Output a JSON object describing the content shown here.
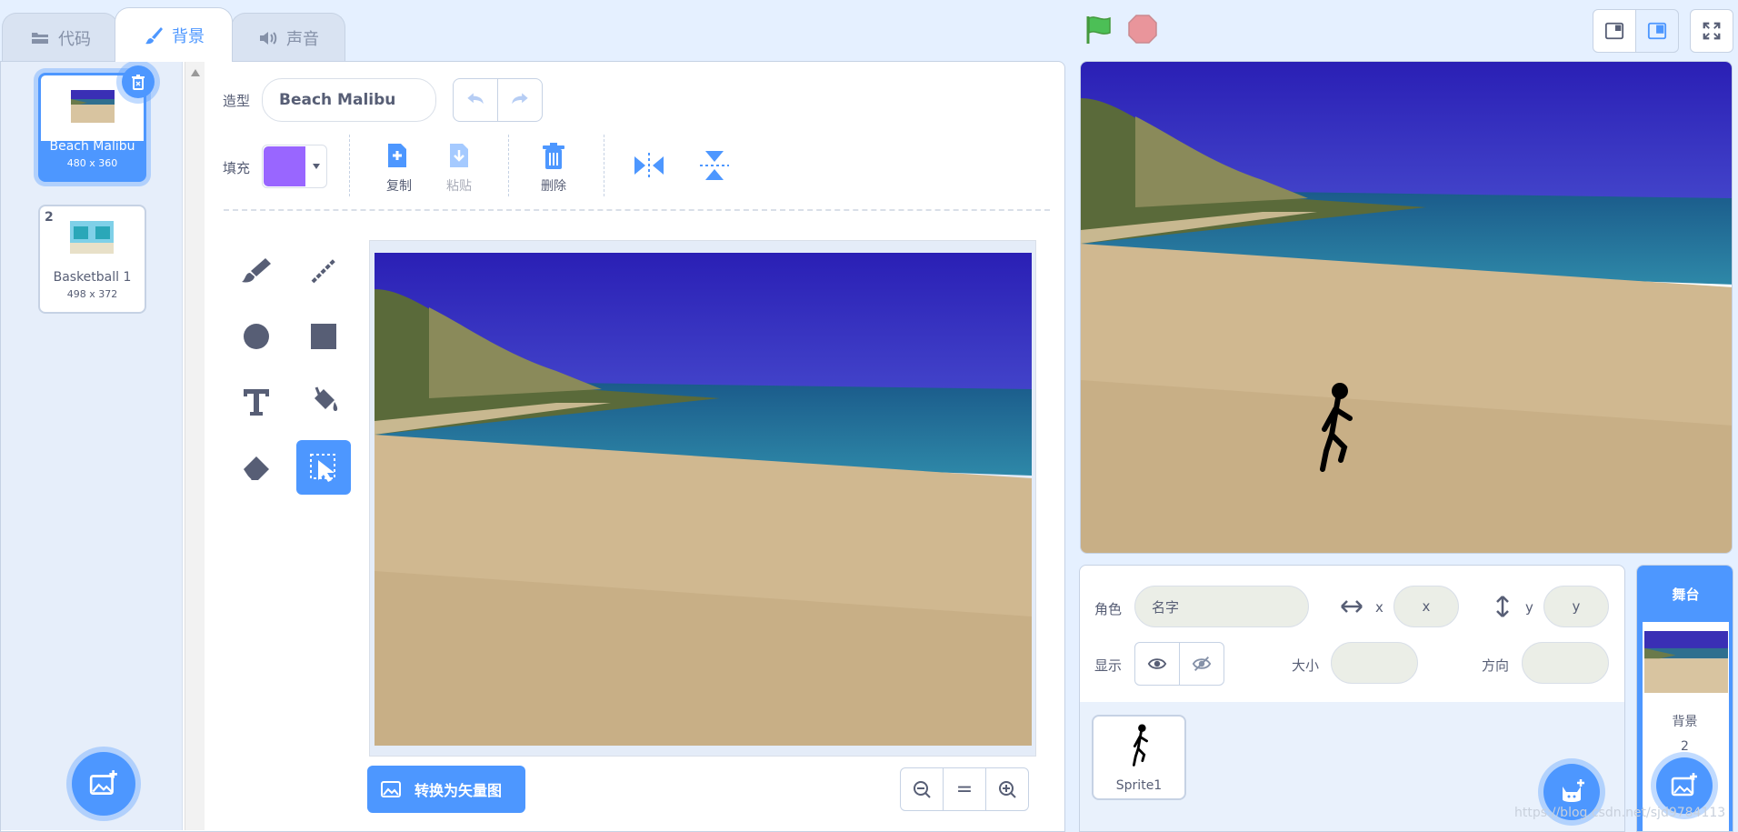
{
  "tabs": {
    "code": "代码",
    "backdrops": "背景",
    "sounds": "声音"
  },
  "costumes": [
    {
      "index": "1",
      "name": "Beach Malibu",
      "size": "480 x 360"
    },
    {
      "index": "2",
      "name": "Basketball 1",
      "size": "498 x 372"
    }
  ],
  "editor": {
    "costume_label": "造型",
    "costume_name": "Beach Malibu",
    "fill_label": "填充",
    "fill_color": "#9966ff",
    "copy_label": "复制",
    "paste_label": "粘贴",
    "delete_label": "删除",
    "convert_button": "转换为矢量图",
    "zoom_reset": "="
  },
  "sprite_info": {
    "sprite_label": "角色",
    "name_placeholder": "名字",
    "x_label": "x",
    "x_placeholder": "x",
    "y_label": "y",
    "y_placeholder": "y",
    "show_label": "显示",
    "size_label": "大小",
    "direction_label": "方向"
  },
  "sprites": [
    {
      "name": "Sprite1"
    }
  ],
  "stage_side": {
    "title": "舞台",
    "backdrop_label": "背景",
    "backdrop_count": "2"
  },
  "watermark": "https://blog.csdn.net/sjd9784113",
  "colors": {
    "accent": "#4d97ff",
    "stop": "#ff8c8c",
    "flag": "#3dba3d"
  }
}
